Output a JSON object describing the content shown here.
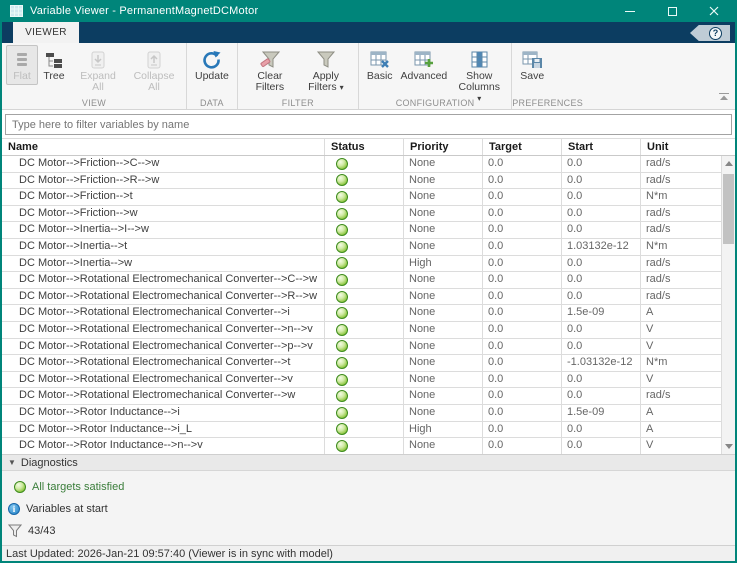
{
  "window": {
    "title": "Variable Viewer - PermanentMagnetDCMotor"
  },
  "ribbon_tab": "VIEWER",
  "toolbar": {
    "sections": [
      {
        "label": "VIEW",
        "buttons": [
          {
            "label": "Flat",
            "disabled": true,
            "pressed": true
          },
          {
            "label": "Tree",
            "disabled": false
          },
          {
            "label": "Expand All",
            "disabled": true
          },
          {
            "label": "Collapse All",
            "disabled": true
          }
        ]
      },
      {
        "label": "DATA",
        "buttons": [
          {
            "label": "Update",
            "disabled": false
          }
        ]
      },
      {
        "label": "FILTER",
        "buttons": [
          {
            "label": "Clear Filters",
            "disabled": false
          },
          {
            "label": "Apply Filters",
            "disabled": false,
            "caret": true
          }
        ]
      },
      {
        "label": "CONFIGURATION",
        "buttons": [
          {
            "label": "Basic",
            "disabled": false
          },
          {
            "label": "Advanced",
            "disabled": false
          },
          {
            "label": "Show Columns",
            "disabled": false,
            "caret": true
          }
        ]
      },
      {
        "label": "PREFERENCES",
        "buttons": [
          {
            "label": "Save",
            "disabled": false
          }
        ]
      }
    ]
  },
  "filter": {
    "placeholder": "Type here to filter variables by name"
  },
  "table": {
    "columns": [
      "Name",
      "Status",
      "Priority",
      "Target",
      "Start",
      "Unit"
    ],
    "rows": [
      {
        "name": "DC Motor-->Friction-->C-->w",
        "status": "ok",
        "priority": "None",
        "target": "0.0",
        "start": "0.0",
        "unit": "rad/s"
      },
      {
        "name": "DC Motor-->Friction-->R-->w",
        "status": "ok",
        "priority": "None",
        "target": "0.0",
        "start": "0.0",
        "unit": "rad/s"
      },
      {
        "name": "DC Motor-->Friction-->t",
        "status": "ok",
        "priority": "None",
        "target": "0.0",
        "start": "0.0",
        "unit": "N*m"
      },
      {
        "name": "DC Motor-->Friction-->w",
        "status": "ok",
        "priority": "None",
        "target": "0.0",
        "start": "0.0",
        "unit": "rad/s"
      },
      {
        "name": "DC Motor-->Inertia-->I-->w",
        "status": "ok",
        "priority": "None",
        "target": "0.0",
        "start": "0.0",
        "unit": "rad/s"
      },
      {
        "name": "DC Motor-->Inertia-->t",
        "status": "ok",
        "priority": "None",
        "target": "0.0",
        "start": "1.03132e-12",
        "unit": "N*m"
      },
      {
        "name": "DC Motor-->Inertia-->w",
        "status": "ok",
        "priority": "High",
        "target": "0.0",
        "start": "0.0",
        "unit": "rad/s"
      },
      {
        "name": "DC Motor-->Rotational Electromechanical Converter-->C-->w",
        "status": "ok",
        "priority": "None",
        "target": "0.0",
        "start": "0.0",
        "unit": "rad/s"
      },
      {
        "name": "DC Motor-->Rotational Electromechanical Converter-->R-->w",
        "status": "ok",
        "priority": "None",
        "target": "0.0",
        "start": "0.0",
        "unit": "rad/s"
      },
      {
        "name": "DC Motor-->Rotational Electromechanical Converter-->i",
        "status": "ok",
        "priority": "None",
        "target": "0.0",
        "start": "1.5e-09",
        "unit": "A"
      },
      {
        "name": "DC Motor-->Rotational Electromechanical Converter-->n-->v",
        "status": "ok",
        "priority": "None",
        "target": "0.0",
        "start": "0.0",
        "unit": "V"
      },
      {
        "name": "DC Motor-->Rotational Electromechanical Converter-->p-->v",
        "status": "ok",
        "priority": "None",
        "target": "0.0",
        "start": "0.0",
        "unit": "V"
      },
      {
        "name": "DC Motor-->Rotational Electromechanical Converter-->t",
        "status": "ok",
        "priority": "None",
        "target": "0.0",
        "start": "-1.03132e-12",
        "unit": "N*m"
      },
      {
        "name": "DC Motor-->Rotational Electromechanical Converter-->v",
        "status": "ok",
        "priority": "None",
        "target": "0.0",
        "start": "0.0",
        "unit": "V"
      },
      {
        "name": "DC Motor-->Rotational Electromechanical Converter-->w",
        "status": "ok",
        "priority": "None",
        "target": "0.0",
        "start": "0.0",
        "unit": "rad/s"
      },
      {
        "name": "DC Motor-->Rotor Inductance-->i",
        "status": "ok",
        "priority": "None",
        "target": "0.0",
        "start": "1.5e-09",
        "unit": "A"
      },
      {
        "name": "DC Motor-->Rotor Inductance-->i_L",
        "status": "ok",
        "priority": "High",
        "target": "0.0",
        "start": "0.0",
        "unit": "A"
      },
      {
        "name": "DC Motor-->Rotor Inductance-->n-->v",
        "status": "ok",
        "priority": "None",
        "target": "0.0",
        "start": "0.0",
        "unit": "V"
      }
    ]
  },
  "diagnostics": {
    "header": "Diagnostics",
    "items": [
      {
        "icon": "green-led",
        "text": "All targets satisfied"
      },
      {
        "icon": "info",
        "text": "Variables at start"
      },
      {
        "icon": "filter-funnel",
        "text": "43/43"
      }
    ]
  },
  "status_bar": "Last Updated: 2026-Jan-21 09:57:40 (Viewer is in sync with model)",
  "colors": {
    "accent_teal": "#00857a",
    "tabstrip_navy": "#0c3d61",
    "status_ok_green": "#54a021",
    "info_blue": "#1f7fc4"
  }
}
